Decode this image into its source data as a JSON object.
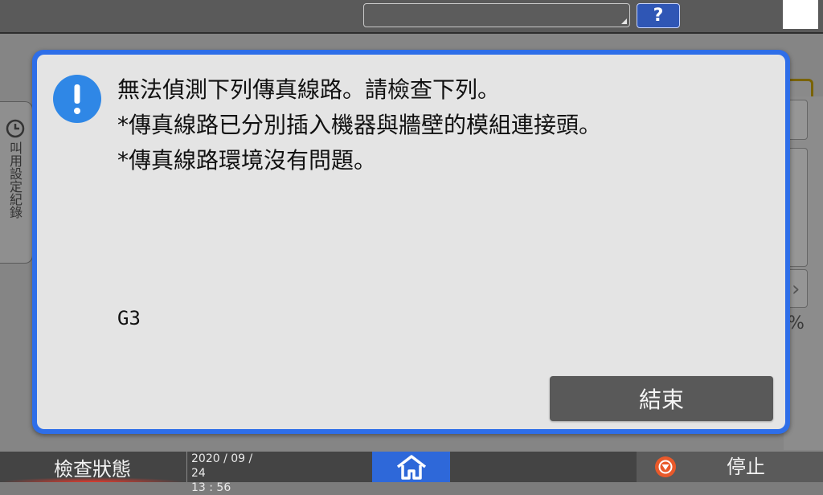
{
  "topbar": {
    "help_label": "?"
  },
  "background": {
    "history_tab_label": "叫用設定紀錄",
    "percent_suffix": "%"
  },
  "dialog": {
    "message_lines": [
      "無法偵測下列傳真線路。請檢查下列。",
      "*傳真線路已分別插入機器與牆壁的模組連接頭。",
      "*傳真線路環境沒有問題。"
    ],
    "line_code": "G3",
    "end_button_label": "結束"
  },
  "bottombar": {
    "status_label": "檢查狀態",
    "date": "2020 / 09 / 24",
    "time": "13 : 56",
    "stop_label": "停止"
  },
  "colors": {
    "dialog_border": "#2e6ee8",
    "alert_icon": "#2f87e6",
    "home_button": "#2e68d9",
    "stop_icon": "#e9592a",
    "help_button": "#2f56b5"
  }
}
